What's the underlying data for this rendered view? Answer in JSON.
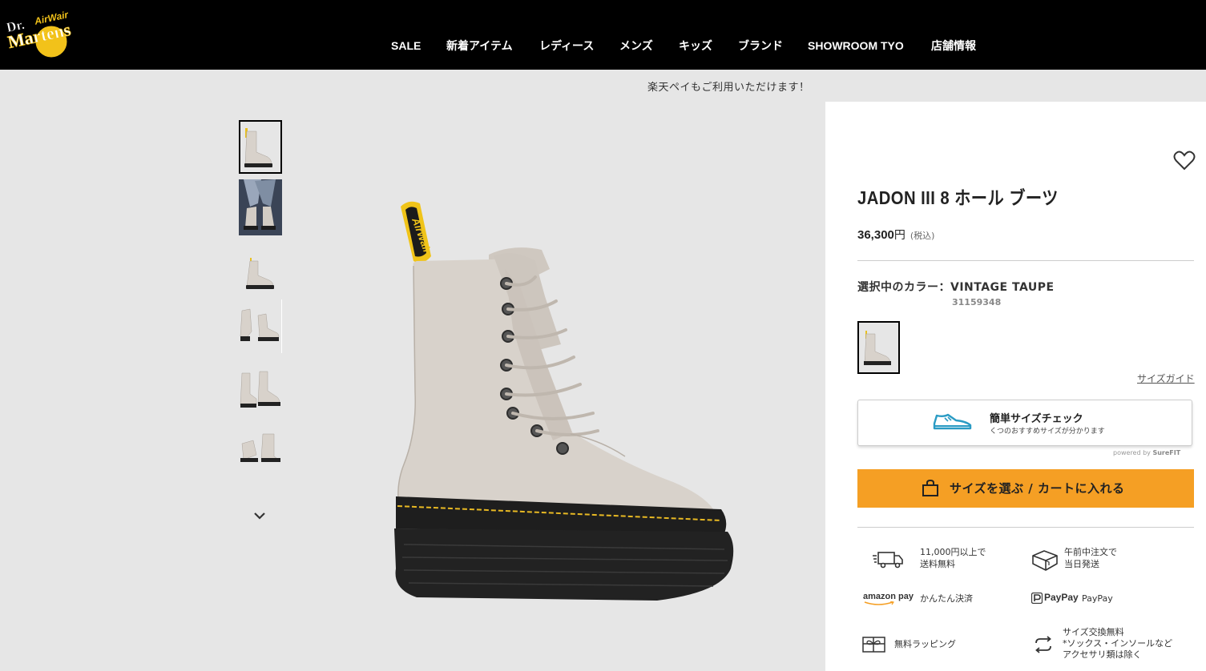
{
  "header": {
    "logo_text_1": "Dr.",
    "logo_text_2": "Martens",
    "logo_text_3": "AirWair",
    "nav": [
      "SALE",
      "新着アイテム",
      "レディース",
      "メンズ",
      "キッズ",
      "ブランド",
      "SHOWROOM TYO",
      "店舗情報"
    ]
  },
  "banner": {
    "text": "楽天ペイもご利用いただけます！"
  },
  "gallery": {
    "thumbnail_count": 6,
    "active_index": 0,
    "next_icon": "chevron-down-icon"
  },
  "product": {
    "title": "JADON III 8 ホール ブーツ",
    "price": "36,300",
    "currency": "円",
    "tax_note": "(税込)",
    "color_label": "選択中のカラー：VINTAGE TAUPE",
    "sku": "31159348",
    "size_guide": "サイズガイド",
    "wishlist_icon": "heart-icon"
  },
  "surefit": {
    "title": "簡単サイズチェック",
    "subtitle": "くつのおすすめサイズが分かります",
    "powered_prefix": "powered by",
    "powered_brand": "SureFIT",
    "icon": "sneaker-icon"
  },
  "cart": {
    "label": "サイズを選ぶ / カートに入れる",
    "icon": "shopping-bag-icon",
    "color": "#f59f24"
  },
  "features": [
    {
      "icon": "delivery-truck-icon",
      "lines": [
        "11,000円以上で",
        "送料無料"
      ]
    },
    {
      "icon": "package-icon",
      "lines": [
        "午前中注文で",
        "当日発送"
      ]
    },
    {
      "icon": "amazon-pay-logo",
      "logo": "amazon pay",
      "lines": [
        "かんたん決済"
      ]
    },
    {
      "icon": "paypay-logo",
      "logo": "PayPay",
      "lines": [
        "PayPay"
      ]
    },
    {
      "icon": "gift-icon",
      "lines": [
        "無料ラッピング"
      ]
    },
    {
      "icon": "exchange-icon",
      "lines": [
        "サイズ交換無料",
        "*ソックス・インソールなど",
        "アクセサリ類は除く"
      ]
    }
  ],
  "colors": {
    "header_bg": "#000000",
    "page_bg": "#e6e6e6",
    "accent": "#f59f24",
    "surefit_blue": "#2a9bc4",
    "boot_leather": "#d8d2cb",
    "boot_sole": "#1e1e1e",
    "stitch_yellow": "#e8b923"
  }
}
